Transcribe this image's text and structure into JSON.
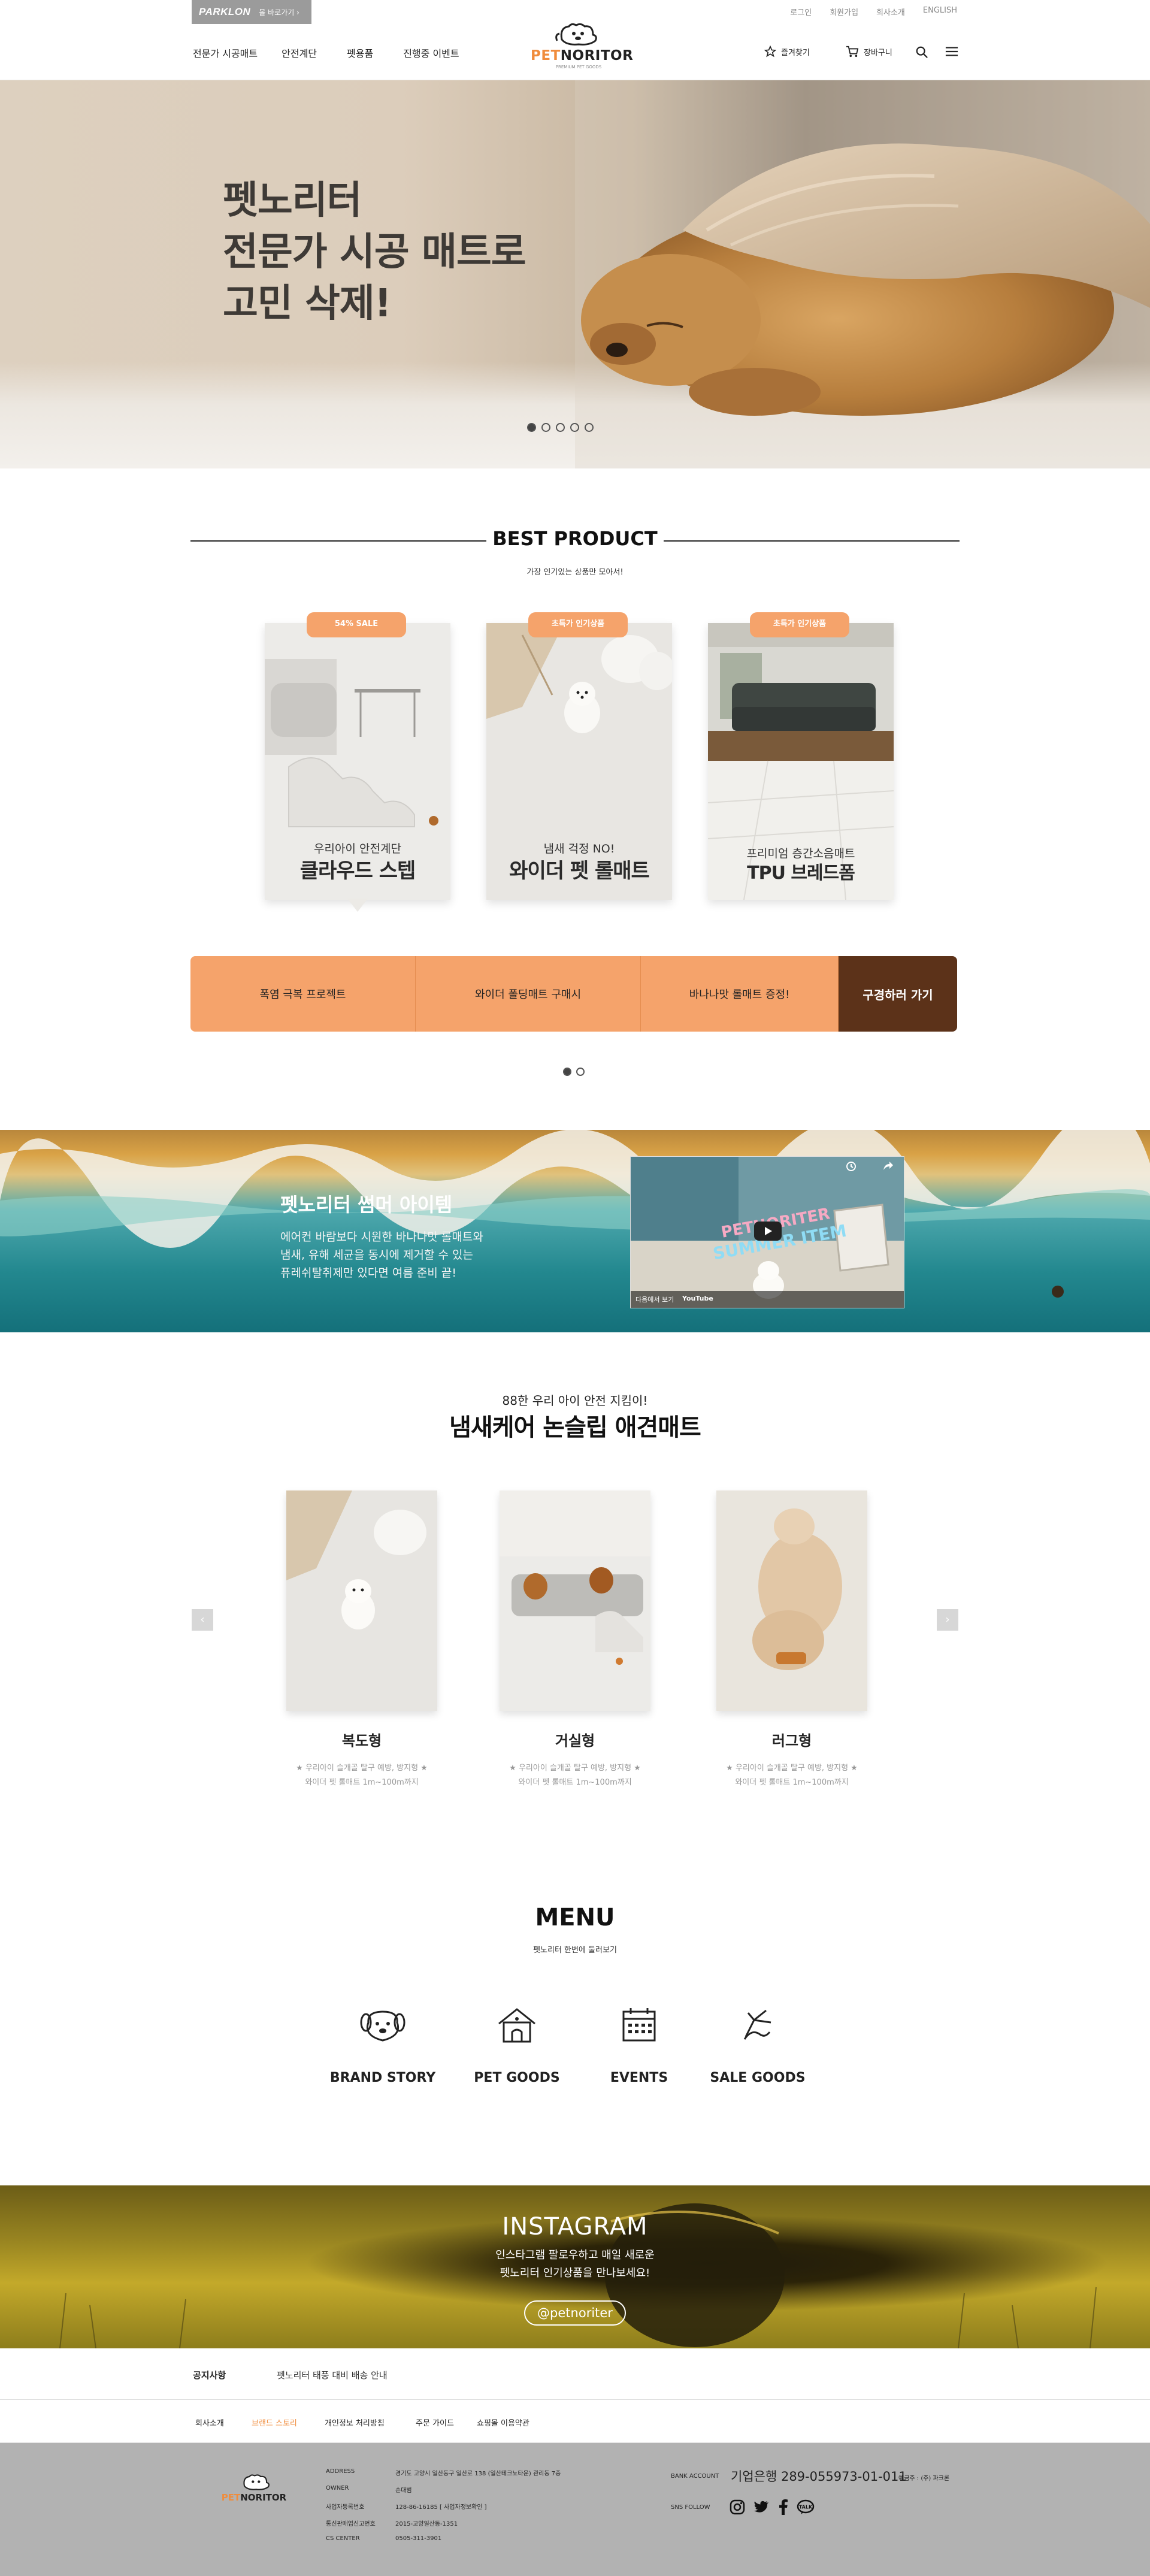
{
  "header": {
    "parklon_logo": "PARKLON",
    "parklon_link": "몰 바로가기 ›",
    "top_links": [
      "로그인",
      "회원가입",
      "회사소개",
      "ENGLISH"
    ],
    "gnb": [
      "전문가 시공매트",
      "안전계단",
      "펫용품",
      "진행중 이벤트"
    ],
    "brand_word_a": "PET",
    "brand_word_b": "NORITOR",
    "brand_tagline": "PREMIUM PET GOODS",
    "favorites_label": "즐겨찾기",
    "cart_label": "장바구니"
  },
  "hero": {
    "line1": "펫노리터",
    "line2": "전문가 시공 매트로",
    "line3": "고민 삭제!",
    "slide_count": 5,
    "active_slide": 1
  },
  "best": {
    "title": "BEST PRODUCT",
    "subtitle": "가장 인기있는 상품만 모아서!",
    "products": [
      {
        "badge": "54% SALE",
        "sub": "우리아이 안전계단",
        "name": "클라우드 스텝"
      },
      {
        "badge": "초특가 인기상품",
        "sub": "냄새 걱정 NO!",
        "name": "와이더 펫 롤매트"
      },
      {
        "badge": "초특가 인기상품",
        "sub": "프리미엄 층간소음매트",
        "name": "TPU 브레드폼"
      }
    ],
    "tabs": [
      "폭염 극복 프로젝트",
      "와이더 폴딩매트 구매시",
      "바나나맛 롤매트 증정!"
    ],
    "cta": "구경하러 가기"
  },
  "summer": {
    "title": "펫노리터 썸머 아이템",
    "desc_line1": "에어컨 바람보다 시원한 바나나맛 롤매트와",
    "desc_line2": "냄새, 유해 세균을 동시에 제거할 수 있는",
    "desc_line3": "퓨레쉬탈취제만 있다면 여름 준비 끝!",
    "video_text1": "PETNORITER",
    "video_text2": "SUMMER ITEM",
    "video_bar": "다음에서 보기",
    "video_brand": "YouTube"
  },
  "mat": {
    "subtitle": "88한 우리 아이 안전 지킴이!",
    "title": "냄새케어 논슬립 애견매트",
    "items": [
      {
        "name": "복도형",
        "desc1": "★ 우리아이 슬개골 탈구 예방, 방지형 ★",
        "desc2": "와이더 펫 롤매트 1m~100m까지"
      },
      {
        "name": "거실형",
        "desc1": "★ 우리아이 슬개골 탈구 예방, 방지형 ★",
        "desc2": "와이더 펫 롤매트 1m~100m까지"
      },
      {
        "name": "러그형",
        "desc1": "★ 우리아이 슬개골 탈구 예방, 방지형 ★",
        "desc2": "와이더 펫 롤매트 1m~100m까지"
      }
    ],
    "prev": "‹",
    "next": "›"
  },
  "menu": {
    "title": "MENU",
    "subtitle": "펫노리터 한번에 둘러보기",
    "items": [
      "BRAND STORY",
      "PET GOODS",
      "EVENTS",
      "SALE GOODS"
    ]
  },
  "instagram": {
    "title": "INSTAGRAM",
    "desc_line1": "인스타그램 팔로우하고 매일 새로운",
    "desc_line2": "펫노리터 인기상품을 만나보세요!",
    "handle": "@petnoriter"
  },
  "notice": {
    "label": "공지사항",
    "text": "펫노리터 태풍 대비 배송 안내"
  },
  "footer_nav": [
    "회사소개",
    "브랜드 스토리",
    "개인정보 처리방침",
    "주문 가이드",
    "쇼핑몰 이용약관"
  ],
  "footer": {
    "info": [
      {
        "label": "ADDRESS",
        "value": "경기도 고양시 일산동구 일산로 138 (일산테크노타운) 관리동 7층"
      },
      {
        "label": "OWNER",
        "value": "손대범"
      },
      {
        "label": "사업자등록번호",
        "value": "128-86-16185 [ 사업자정보확인 ]"
      },
      {
        "label": "통신판매업신고번호",
        "value": "2015-고양일산동-1351"
      },
      {
        "label": "CS CENTER",
        "value": "0505-311-3901"
      }
    ],
    "bank_label": "BANK ACCOUNT",
    "bank_value": "기업은행 289-055973-01-011",
    "bank_holder": "예금주 : (주) 파크론",
    "sns_label": "SNS FOLLOW"
  },
  "colors": {
    "accent": "#f5a36b",
    "cta": "#5c3219",
    "footer_bg": "#b2b2b2"
  }
}
